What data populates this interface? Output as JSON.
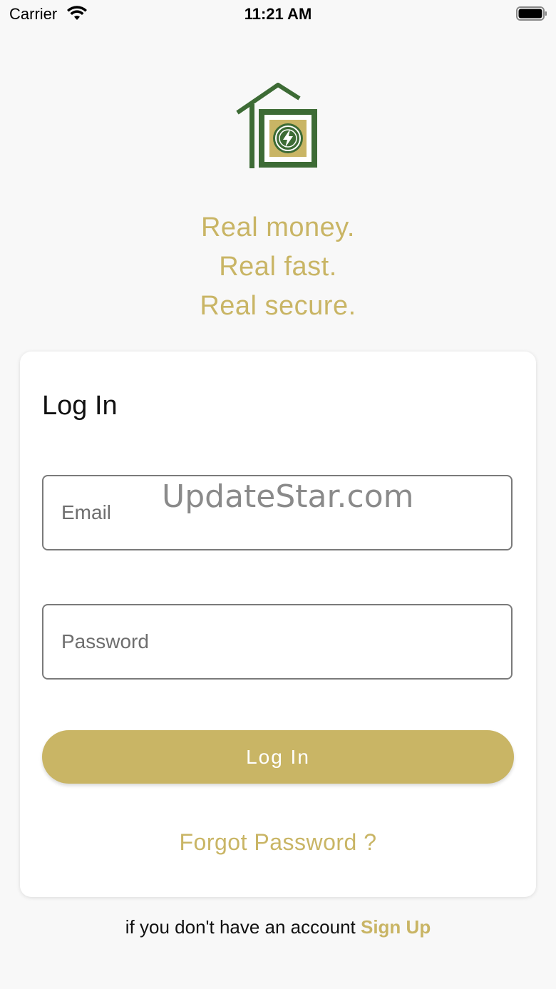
{
  "status_bar": {
    "carrier": "Carrier",
    "time": "11:21 AM"
  },
  "brand": {
    "accent_color": "#c9b565",
    "logo_color": "#3d6b35",
    "logo_icon": "house-lightning-coin-icon"
  },
  "tagline": {
    "line1": "Real money.",
    "line2": "Real fast.",
    "line3": "Real secure."
  },
  "login_card": {
    "title": "Log In",
    "email_placeholder": "Email",
    "password_placeholder": "Password",
    "login_label": "Log In",
    "forgot_label": "Forgot Password ?"
  },
  "watermark": "UpdateStar.com",
  "footer": {
    "prompt": "if you don't have an account",
    "signup_label": "Sign Up"
  }
}
